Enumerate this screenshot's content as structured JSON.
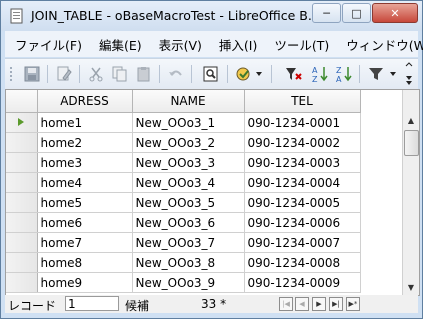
{
  "window": {
    "title": "JOIN_TABLE - oBaseMacroTest - LibreOffice B...",
    "minimize_glyph": "─",
    "maximize_glyph": "□",
    "close_glyph": "✕"
  },
  "menubar": {
    "items": [
      {
        "label": "ファイル(F)"
      },
      {
        "label": "編集(E)"
      },
      {
        "label": "表示(V)"
      },
      {
        "label": "挿入(I)"
      },
      {
        "label": "ツール(T)"
      },
      {
        "label": "ウィンドウ(W"
      }
    ]
  },
  "toolbar": {
    "buttons": [
      "save-icon",
      "edit-icon",
      "cut-icon",
      "copy-icon",
      "paste-icon",
      "undo-icon",
      "print-preview-icon",
      "autocomplete-icon",
      "filter-icon",
      "sort-ascending-icon",
      "sort-descending-icon",
      "autofilter-icon"
    ]
  },
  "table": {
    "columns": [
      "ADRESS",
      "NAME",
      "TEL"
    ],
    "rows": [
      {
        "adress": "home1",
        "name": "New_OOo3_1",
        "tel": "090-1234-0001"
      },
      {
        "adress": "home2",
        "name": "New_OOo3_2",
        "tel": "090-1234-0002"
      },
      {
        "adress": "home3",
        "name": "New_OOo3_3",
        "tel": "090-1234-0003"
      },
      {
        "adress": "home4",
        "name": "New_OOo3_4",
        "tel": "090-1234-0004"
      },
      {
        "adress": "home5",
        "name": "New_OOo3_5",
        "tel": "090-1234-0005"
      },
      {
        "adress": "home6",
        "name": "New_OOo3_6",
        "tel": "090-1234-0006"
      },
      {
        "adress": "home7",
        "name": "New_OOo3_7",
        "tel": "090-1234-0007"
      },
      {
        "adress": "home8",
        "name": "New_OOo3_8",
        "tel": "090-1234-0008"
      },
      {
        "adress": "home9",
        "name": "New_OOo3_9",
        "tel": "090-1234-0009"
      }
    ],
    "current_row": 1
  },
  "statusbar": {
    "record_label": "レコード",
    "record_value": "1",
    "candidate_label": "候補",
    "count": "33 *"
  },
  "colors": {
    "titlebar": "#d6e3f3",
    "close_button": "#c7483b",
    "row_marker": "#5b9a2c"
  }
}
